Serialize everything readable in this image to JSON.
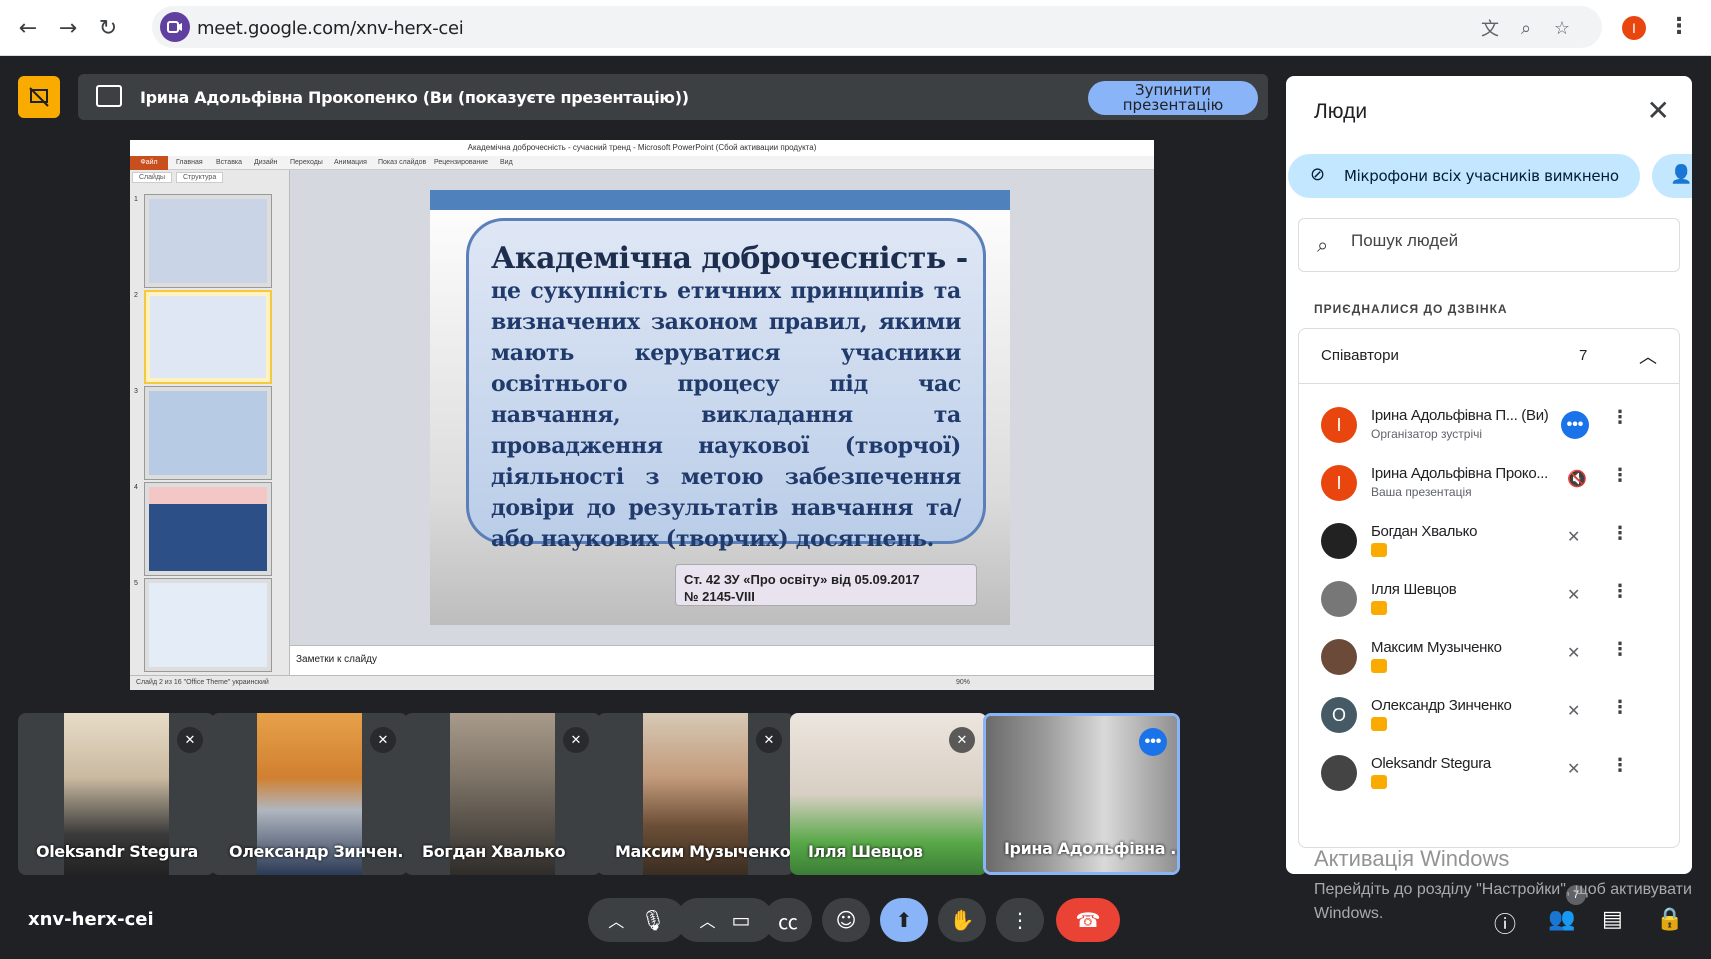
{
  "browser": {
    "url": "meet.google.com/xnv-herx-cei",
    "profile_initial": "I"
  },
  "presenting_bar": {
    "text": "Ірина Адольфівна Прокопенко (Ви (показуєте презентацію))",
    "stop_button_line1": "Зупинити",
    "stop_button_line2": "презентацію"
  },
  "ppt": {
    "window_title": "Академічна доброчесність - сучасний тренд - Microsoft PowerPoint (Сбой активации продукта)",
    "file_tab": "Файл",
    "tabs": [
      "Главная",
      "Вставка",
      "Дизайн",
      "Переходы",
      "Анимация",
      "Показ слайдов",
      "Рецензирование",
      "Вид"
    ],
    "side_tabs": [
      "Слайды",
      "Структура"
    ],
    "thumbnails": [
      "1",
      "2",
      "3",
      "4",
      "5"
    ],
    "notes_placeholder": "Заметки к слайду",
    "status_text": "Слайд 2 из 16   \"Office Theme\"   украинский",
    "zoom": "90%"
  },
  "slide": {
    "heading": "Академічна доброчесність -",
    "body": "це сукупність етичних принципів та визначених законом правил, якими мають керуватися учасники освітнього процесу під час навчання, викладання та провадження наукової (творчої) діяльності з метою забезпечення довіри до результатів навчання та/або наукових (творчих) досягнень.",
    "cite_line1": "Ст. 42 ЗУ «Про освіту» від 05.09.2017",
    "cite_line2": "№ 2145-VIII"
  },
  "tiles": [
    {
      "name": "Oleksandr Stegura"
    },
    {
      "name": "Олександр Зинчен..."
    },
    {
      "name": "Богдан Хвалько"
    },
    {
      "name": "Максим Музыченко"
    },
    {
      "name": "Ілля Шевцов"
    },
    {
      "name": "Ірина Адольфівна ..."
    }
  ],
  "meeting_code": "xnv-herx-cei",
  "people_panel": {
    "title": "Люди",
    "mute_all": "Мікрофони всіх учасників вимкнено",
    "search_placeholder": "Пошук людей",
    "joined_label": "ПРИЄДНАЛИСЯ ДО ДЗВІНКА",
    "group_label": "Співавтори",
    "group_count": "7",
    "people": [
      {
        "name": "Ірина Адольфівна П...  (Ви)",
        "sub": "Організатор зустрічі",
        "initial": "I",
        "color": "#e8450f"
      },
      {
        "name": "Ірина Адольфівна Проко...",
        "sub": "Ваша презентація",
        "initial": "I",
        "color": "#e8450f"
      },
      {
        "name": "Богдан Хвалько",
        "sub": "",
        "initial": "",
        "color": "#222222"
      },
      {
        "name": "Ілля Шевцов",
        "sub": "",
        "initial": "",
        "color": "#777777"
      },
      {
        "name": "Максим Музыченко",
        "sub": "",
        "initial": "",
        "color": "#6b4a3a"
      },
      {
        "name": "Олександр Зинченко",
        "sub": "",
        "initial": "O",
        "color": "#455a64"
      },
      {
        "name": "Oleksandr Stegura",
        "sub": "",
        "initial": "",
        "color": "#444444"
      }
    ]
  },
  "windows_watermark": {
    "line1": "Активація Windows",
    "line2": "Перейдіть до розділу \"Настройки\", щоб активувати Windows."
  },
  "people_badge": "7"
}
